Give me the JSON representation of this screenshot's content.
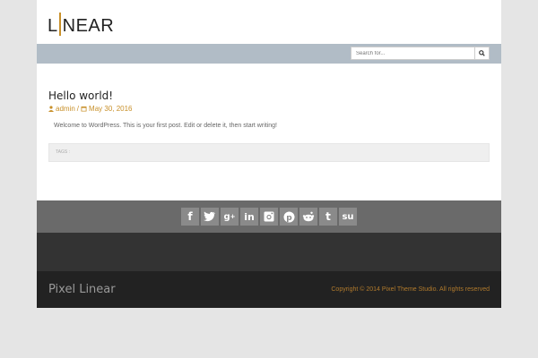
{
  "logo": {
    "text": "LINEAR"
  },
  "search": {
    "placeholder": "Search for..."
  },
  "post": {
    "title": "Hello world!",
    "author": "admin",
    "separator": "/",
    "date": "May 30, 2016",
    "excerpt": "Welcome to WordPress. This is your first post. Edit or delete it, then start writing!",
    "tags_label": "TAGS :"
  },
  "social": [
    "facebook-icon",
    "twitter-icon",
    "google-plus-icon",
    "linkedin-icon",
    "instagram-icon",
    "pinterest-icon",
    "reddit-icon",
    "tumblr-icon",
    "stumbleupon-icon"
  ],
  "footer": {
    "brand": "Pixel Linear",
    "copyright": "Copyright © 2014 Pixel Theme Studio. All rights reserved"
  },
  "colors": {
    "accent": "#c8902a",
    "navbar": "#b1bcc6"
  }
}
